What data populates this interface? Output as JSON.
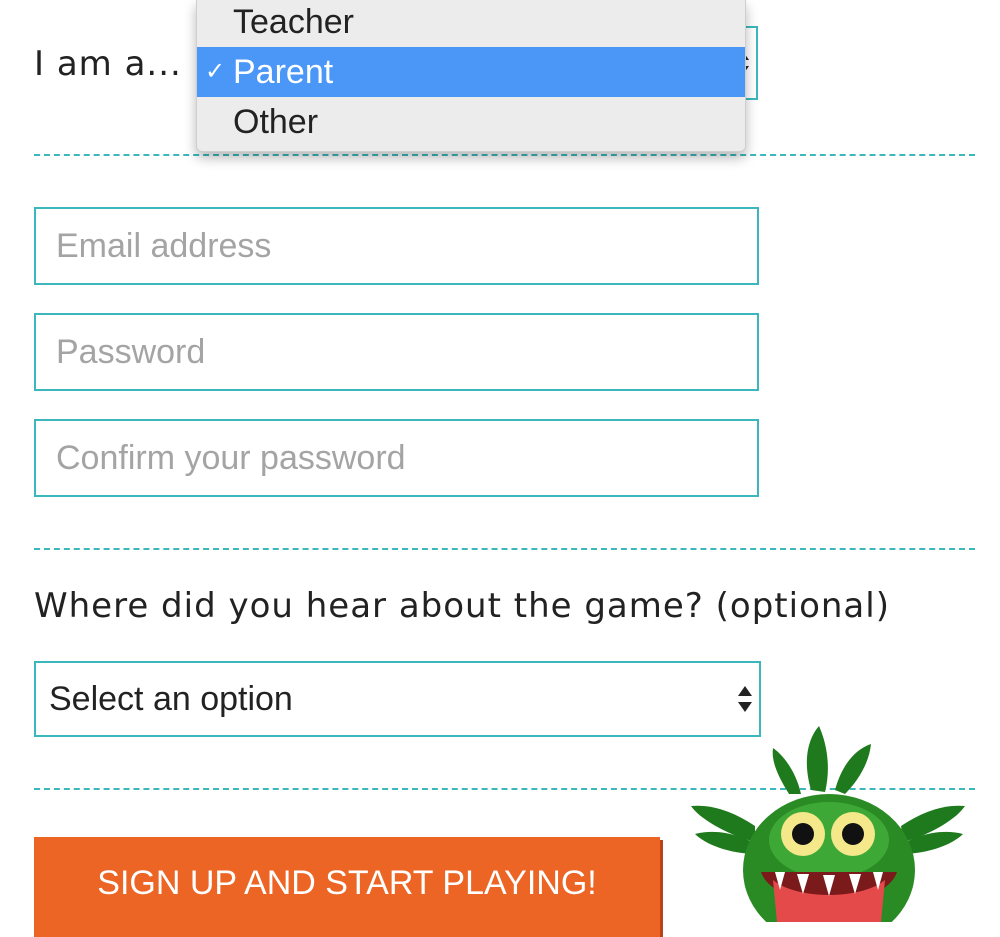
{
  "role": {
    "label": "I am a...",
    "options": [
      "Teacher",
      "Parent",
      "Other"
    ],
    "selected_index": 1,
    "checkmark": "✓"
  },
  "account": {
    "email_placeholder": "Email address",
    "password_placeholder": "Password",
    "confirm_placeholder": "Confirm your password"
  },
  "referral": {
    "question": "Where did you hear about the game? (optional)",
    "selected": "Select an option"
  },
  "signup_button": "SIGN UP AND START PLAYING!",
  "icons": {
    "select_arrows": "up-down-arrows-icon",
    "checkmark": "checkmark-icon",
    "mascot": "green-monster-mascot"
  },
  "colors": {
    "accent": "#3cb8bd",
    "button": "#ec6524",
    "highlight": "#4a97f8",
    "mascot_green": "#2a8a24"
  }
}
